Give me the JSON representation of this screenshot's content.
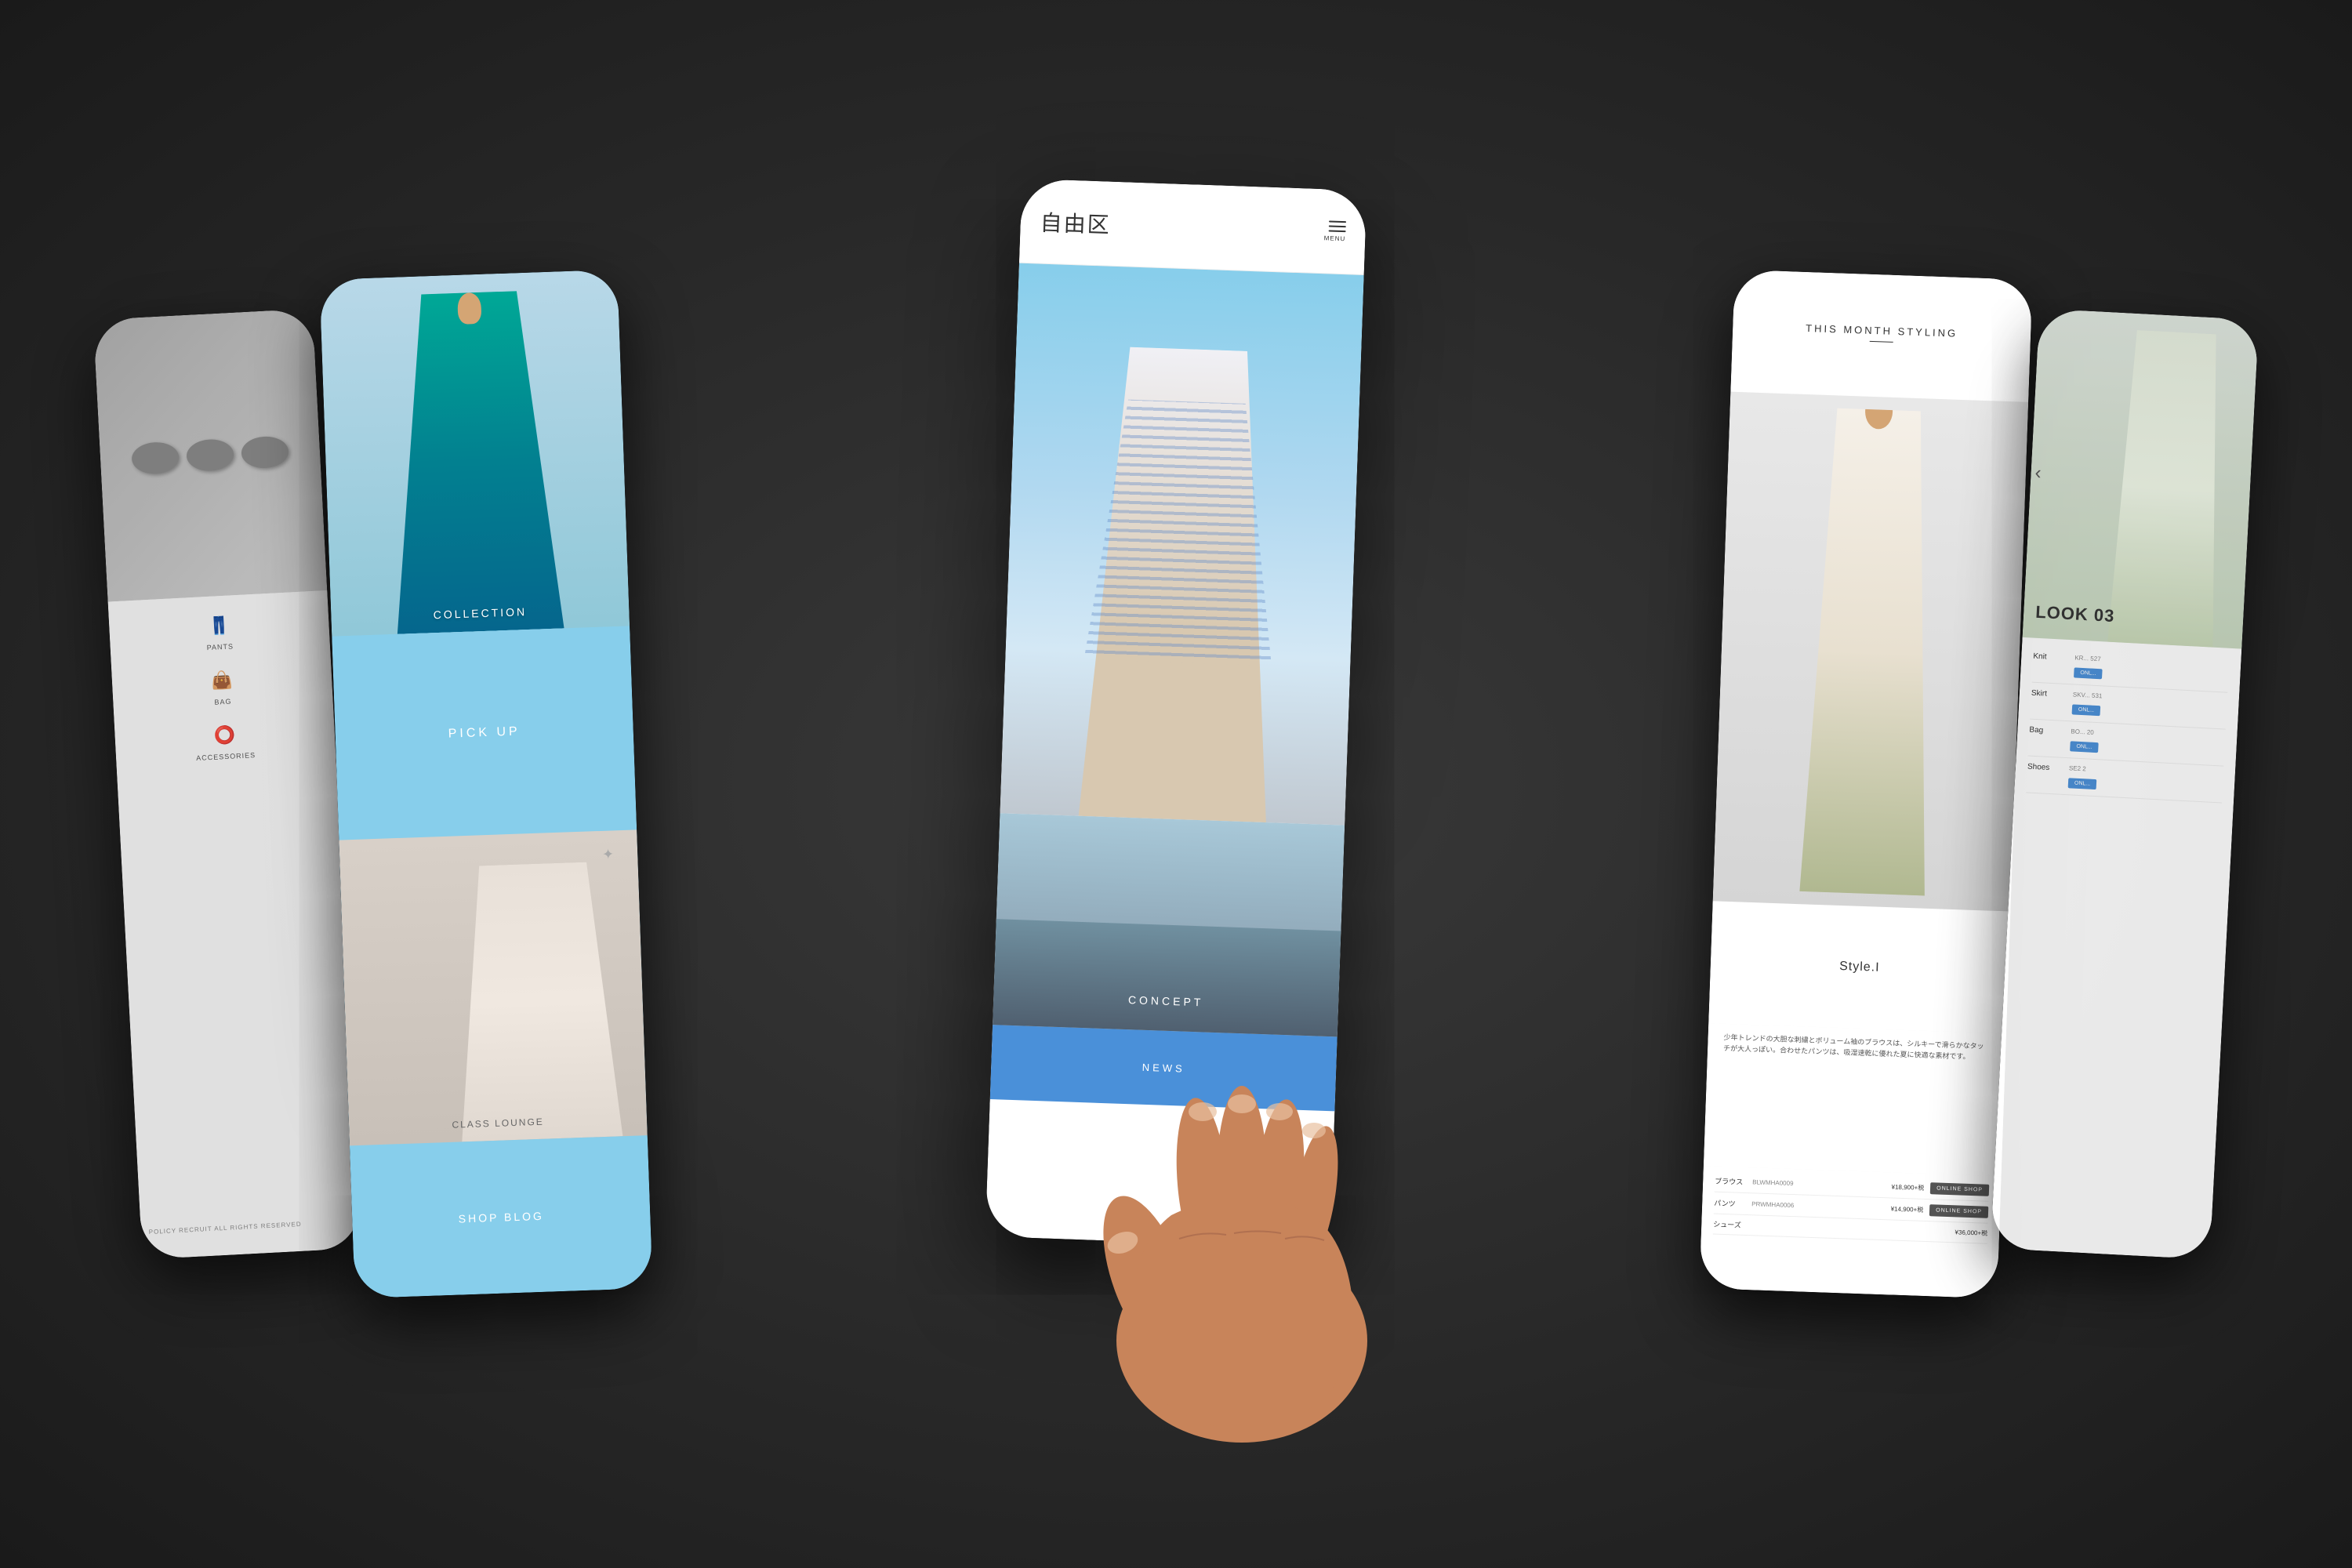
{
  "scene": {
    "background_color": "#2a2a2a"
  },
  "phone1": {
    "stones_alt": "stones background",
    "sidebar_items": [
      {
        "label": "PANTS",
        "icon": "pants"
      },
      {
        "label": "BAG",
        "icon": "bag"
      },
      {
        "label": "ACCESSORIES",
        "icon": "accessories"
      }
    ],
    "footer_links": "POLICY  RECRUIT\nALL RIGHTS RESERVED"
  },
  "phone2": {
    "collection_label": "COLLECTION",
    "pickup_label": "PICK UP",
    "class_label": "CLASS LOUNGE",
    "shopblog_label": "SHOP BLOG"
  },
  "phone3": {
    "brand_logo": "自由区",
    "menu_label": "MENU",
    "concept_label": "CONCEPT",
    "news_label": "NEWS"
  },
  "phone4": {
    "header_title": "THIS MONTH STYLING",
    "style_name": "Style.I",
    "description": "少年トレンドの大胆な刺繍とボリューム袖のブラウスは、シルキーで滑らかなタッチが大人っぽい。合わせたパンツは、吸湿速乾に優れた夏に快適な素材です。",
    "products": [
      {
        "type": "ブラウス",
        "code": "BLWMHA0009",
        "price": "¥18,900+税",
        "btn": "ONLINE SHOP"
      },
      {
        "type": "パンツ",
        "code": "PRWMHA0006",
        "price": "¥14,900+税",
        "btn": "ONLINE SHOP"
      },
      {
        "type": "シューズ",
        "code": "",
        "price": "¥36,000+税",
        "btn": ""
      }
    ]
  },
  "phone5": {
    "look_number": "LOOK 03",
    "chevron": "‹",
    "products": [
      {
        "type": "Knit",
        "code": "KR...\n527",
        "btn": "ONL..."
      },
      {
        "type": "Skirt",
        "code": "SKV...\n531",
        "btn": "ONL..."
      },
      {
        "type": "Bag",
        "code": "BO...\n20",
        "btn": "ONL..."
      },
      {
        "type": "Shoes",
        "code": "SE2\n2",
        "btn": "ONL..."
      }
    ]
  }
}
